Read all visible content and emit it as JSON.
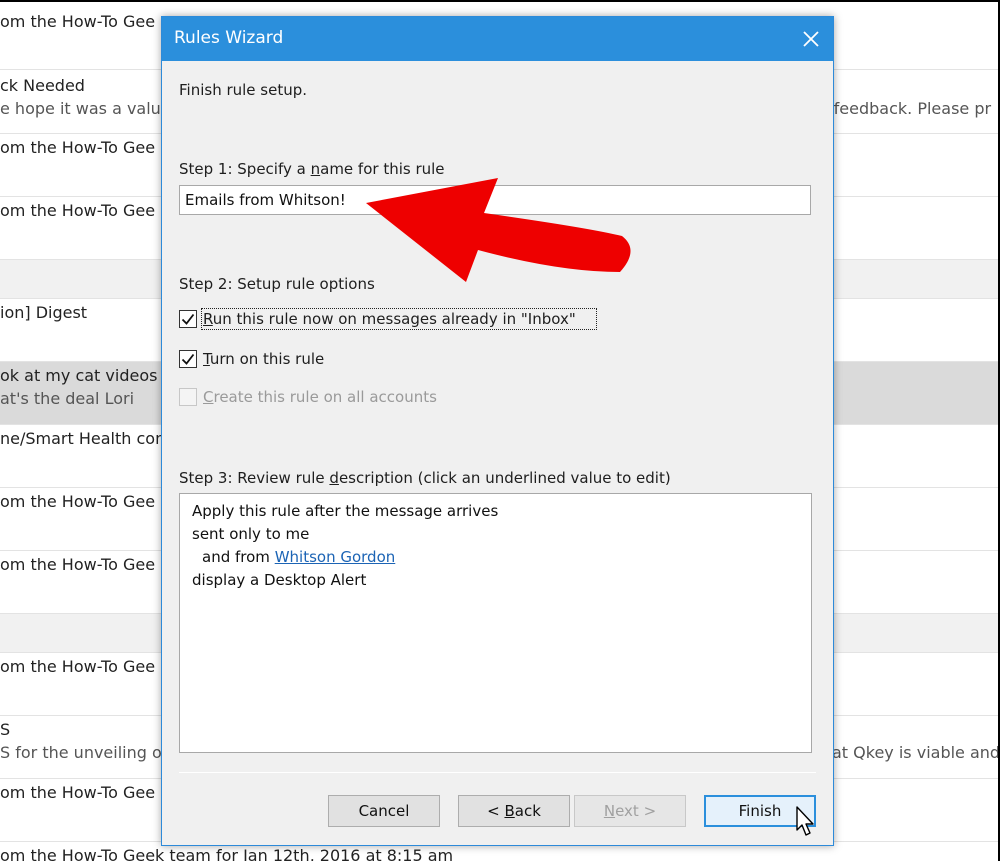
{
  "mail_list": {
    "rows": [
      {
        "line1": "om the How-To Gee",
        "line2": "",
        "right": ""
      },
      {
        "line1": "ck Needed",
        "line2": "e hope it was a valua",
        "right": "r feedback. Please pr"
      },
      {
        "line1": "om the How-To Gee",
        "line2": "",
        "right": ""
      },
      {
        "line1": "om the How-To Gee",
        "line2": "",
        "right": ""
      },
      {
        "line1": "",
        "line2": "",
        "right": ""
      },
      {
        "line1": "ion] Digest",
        "line2": "",
        "right": ""
      },
      {
        "line1": "ok at my cat videos",
        "line2": "at's the deal Lori",
        "right": ""
      },
      {
        "line1": "ne/Smart Health com",
        "line2": "",
        "right": ""
      },
      {
        "line1": "om the How-To Gee",
        "line2": "",
        "right": ""
      },
      {
        "line1": "om the How-To Gee",
        "line2": "",
        "right": ""
      },
      {
        "line1": "",
        "line2": "",
        "right": ""
      },
      {
        "line1": "om the How-To Gee",
        "line2": "",
        "right": ""
      },
      {
        "line1": "S",
        "line2": "S for the unveiling o",
        "right": "at Qkey is viable and"
      },
      {
        "line1": "om the How-To Gee",
        "line2": "",
        "right": ""
      },
      {
        "line1": "om the How-To Geek team for Jan 12th, 2016 at 8:15 am",
        "line2": "",
        "right": ""
      }
    ]
  },
  "dialog": {
    "title": "Rules Wizard",
    "heading": "Finish rule setup.",
    "step1": {
      "pre": "Step 1: Specify a ",
      "ul": "n",
      "post": "ame for this rule"
    },
    "rule_name": "Emails from Whitson!",
    "step2": "Step 2: Setup rule options",
    "options": [
      {
        "ul": "R",
        "rest": "un this rule now on messages already in \"Inbox\"",
        "checked": true,
        "disabled": false
      },
      {
        "ul": "T",
        "rest": "urn on this rule",
        "checked": true,
        "disabled": false
      },
      {
        "ul": "C",
        "rest": "reate this rule on all accounts",
        "checked": false,
        "disabled": true
      }
    ],
    "step3": {
      "pre": "Step 3: Review rule ",
      "ul": "d",
      "post": "escription (click an underlined value to edit)"
    },
    "description": {
      "line1": "Apply this rule after the message arrives",
      "line2": "sent only to me",
      "line3_pre": "and from",
      "line3_link": "Whitson Gordon",
      "line4": "display a Desktop Alert"
    },
    "buttons": {
      "cancel": "Cancel",
      "back": {
        "pre": "< ",
        "ul": "B",
        "rest": "ack"
      },
      "next": {
        "ul": "N",
        "rest": "ext >"
      },
      "finish": "Finish"
    }
  },
  "colors": {
    "titlebar": "#2b8fdc",
    "arrow": "#ee0000",
    "link": "#1c64b5"
  }
}
